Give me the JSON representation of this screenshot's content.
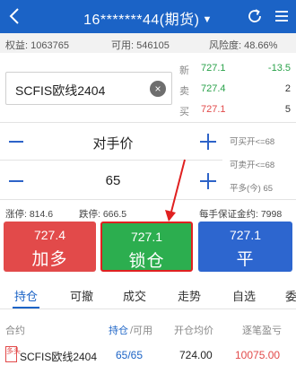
{
  "header": {
    "title": "16*******44(期货)",
    "caret": "▼"
  },
  "account": {
    "equity": "权益: 1063765",
    "available": "可用: 546105",
    "risk": "风险度: 48.66%"
  },
  "symbol": {
    "value": "SCFIS欧线2404",
    "clear_glyph": "×"
  },
  "quotes": [
    {
      "label": "新",
      "price": "727.1",
      "change": "-13.5",
      "price_color": "#2aa24a",
      "change_color": "#2aa24a"
    },
    {
      "label": "卖",
      "price": "727.4",
      "change": "2",
      "price_color": "#2aa24a",
      "change_color": "#333333"
    },
    {
      "label": "买",
      "price": "727.1",
      "change": "5",
      "price_color": "#e24a4a",
      "change_color": "#333333"
    }
  ],
  "price_stepper": {
    "value": "对手价"
  },
  "qty_stepper": {
    "value": "65"
  },
  "avail": {
    "buy_open": "可买开<=68",
    "sell_open": "可卖开<=68",
    "close_today": "平多(今) 65"
  },
  "limits": {
    "up": "涨停: 814.6",
    "down": "跌停: 666.5",
    "margin": "每手保证金约: 7998"
  },
  "buttons": {
    "buy": {
      "price": "727.4",
      "action": "加多"
    },
    "lock": {
      "price": "727.1",
      "action": "锁仓"
    },
    "close": {
      "price": "727.1",
      "action": "平"
    }
  },
  "tabs": [
    "持仓",
    "可撤",
    "成交",
    "走势",
    "自选",
    "委"
  ],
  "table": {
    "headers": {
      "contract": "合约",
      "position": "持仓",
      "available": "/可用",
      "avg_price": "开仓均价",
      "pnl": "逐笔盈亏"
    },
    "rows": [
      {
        "badge": "多头",
        "contract": "SCFIS欧线2404",
        "position": "65/65",
        "avg_price": "724.00",
        "pnl": "10075.00"
      }
    ]
  },
  "colors": {
    "brand_blue": "#1b63c6",
    "up_red": "#e24a4a",
    "lock_green": "#2cae4f",
    "close_blue": "#2d66cf"
  }
}
